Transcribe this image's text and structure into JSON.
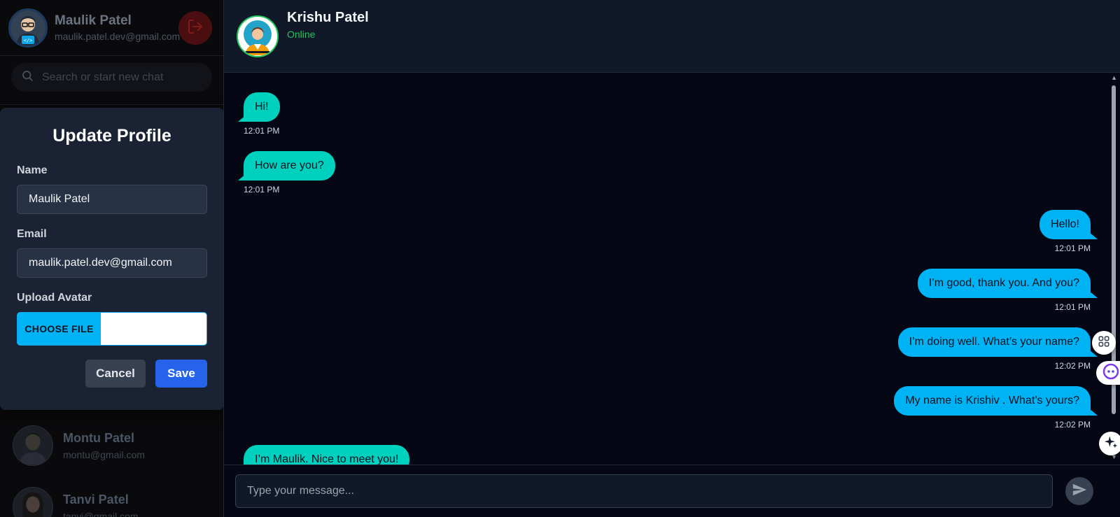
{
  "user": {
    "name": "Maulik Patel",
    "email": "maulik.patel.dev@gmail.com",
    "avatar_icon": "developer-avatar-icon",
    "logout_icon": "logout-icon"
  },
  "search": {
    "placeholder": "Search or start new chat"
  },
  "modal": {
    "title": "Update Profile",
    "name_label": "Name",
    "name_value": "Maulik Patel",
    "email_label": "Email",
    "email_value": "maulik.patel.dev@gmail.com",
    "avatar_label": "Upload Avatar",
    "choose_file_label": "CHOOSE FILE",
    "cancel_label": "Cancel",
    "save_label": "Save"
  },
  "contacts": [
    {
      "name": "Montu Patel",
      "email": "montu@gmail.com"
    },
    {
      "name": "Tanvi Patel",
      "email": "tanvi@gmail.com"
    }
  ],
  "chat": {
    "name": "Krishu Patel",
    "status": "Online",
    "composer_placeholder": "Type your message...",
    "messages": [
      {
        "direction": "in",
        "text": "Hi!",
        "time": "12:01 PM"
      },
      {
        "direction": "in",
        "text": "How are you?",
        "time": "12:01 PM"
      },
      {
        "direction": "out",
        "text": "Hello!",
        "time": "12:01 PM"
      },
      {
        "direction": "out",
        "text": "I’m good, thank you. And you?",
        "time": "12:01 PM"
      },
      {
        "direction": "out",
        "text": "I’m doing well. What’s your name?",
        "time": "12:02 PM"
      },
      {
        "direction": "out",
        "text": "My name is Krishiv . What’s yours?",
        "time": "12:02 PM"
      },
      {
        "direction": "in",
        "text": "I’m Maulik. Nice to meet you!",
        "time": ""
      }
    ]
  },
  "colors": {
    "incoming_bubble": "#00d1bf",
    "outgoing_bubble": "#00b3f5",
    "online": "#22c55e",
    "save_button": "#2563eb"
  }
}
